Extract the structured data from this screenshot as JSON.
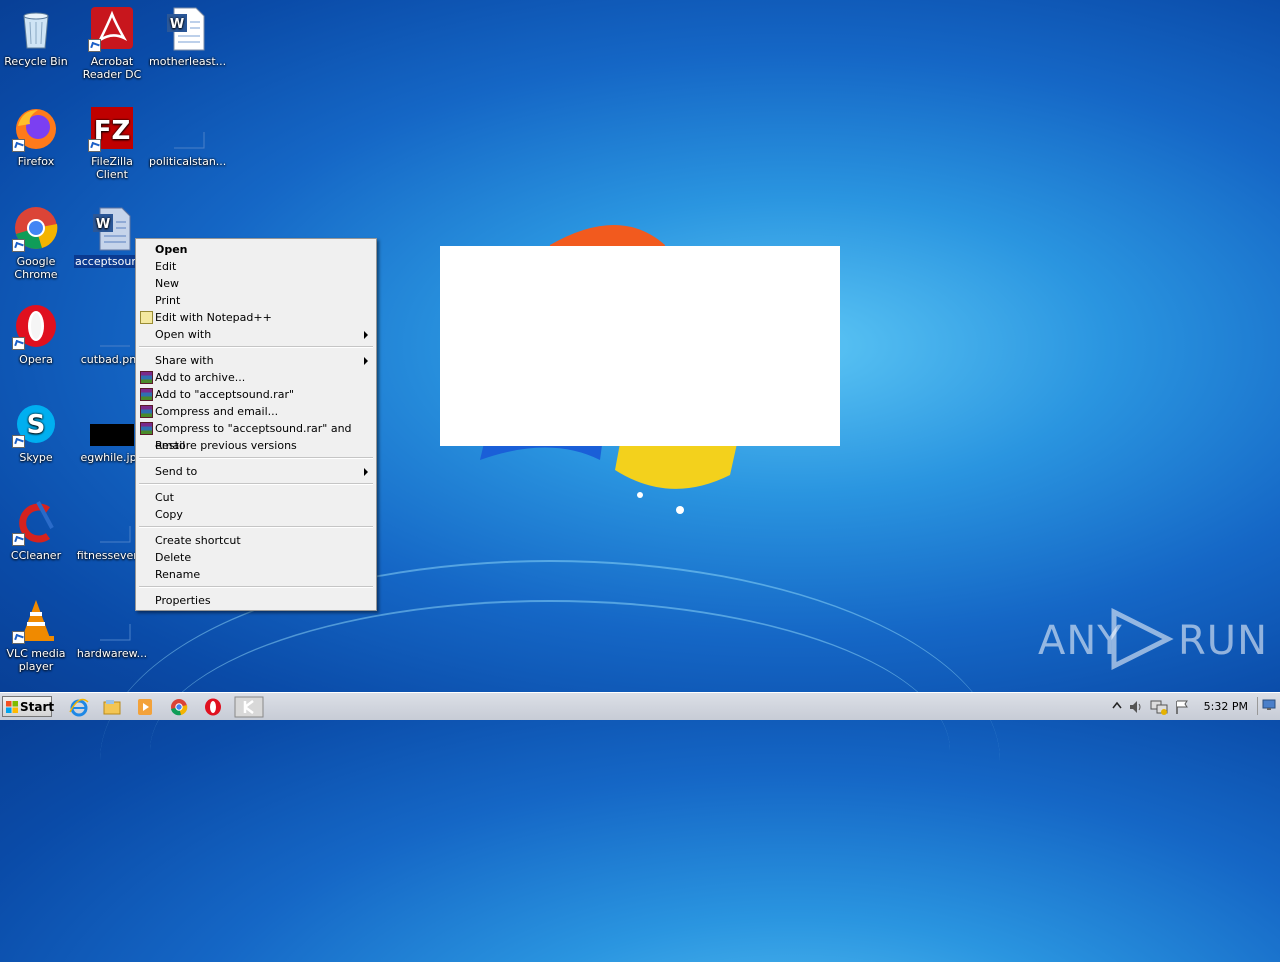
{
  "desktop": {
    "icons": [
      {
        "label": "Recycle Bin"
      },
      {
        "label": "Acrobat Reader DC"
      },
      {
        "label": "motherleast..."
      },
      {
        "label": "Firefox"
      },
      {
        "label": "FileZilla Client"
      },
      {
        "label": "politicalstan..."
      },
      {
        "label": "Google Chrome"
      },
      {
        "label": "acceptsound.rtf"
      },
      {
        "label": "Opera"
      },
      {
        "label": "cutbad.png"
      },
      {
        "label": "Skype"
      },
      {
        "label": "egwhile.jpg"
      },
      {
        "label": "CCleaner"
      },
      {
        "label": "fitnessever..."
      },
      {
        "label": "VLC media player"
      },
      {
        "label": "hardwarew..."
      }
    ]
  },
  "context_menu": {
    "items": [
      {
        "label": "Open"
      },
      {
        "label": "Edit"
      },
      {
        "label": "New"
      },
      {
        "label": "Print"
      },
      {
        "label": "Edit with Notepad++"
      },
      {
        "label": "Open with"
      },
      {
        "label": "Share with"
      },
      {
        "label": "Add to archive..."
      },
      {
        "label": "Add to \"acceptsound.rar\""
      },
      {
        "label": "Compress and email..."
      },
      {
        "label": "Compress to \"acceptsound.rar\" and email"
      },
      {
        "label": "Restore previous versions"
      },
      {
        "label": "Send to"
      },
      {
        "label": "Cut"
      },
      {
        "label": "Copy"
      },
      {
        "label": "Create shortcut"
      },
      {
        "label": "Delete"
      },
      {
        "label": "Rename"
      },
      {
        "label": "Properties"
      }
    ]
  },
  "taskbar": {
    "start_label": "Start",
    "clock": "5:32 PM"
  },
  "watermark": {
    "left": "ANY",
    "right": "RUN"
  }
}
